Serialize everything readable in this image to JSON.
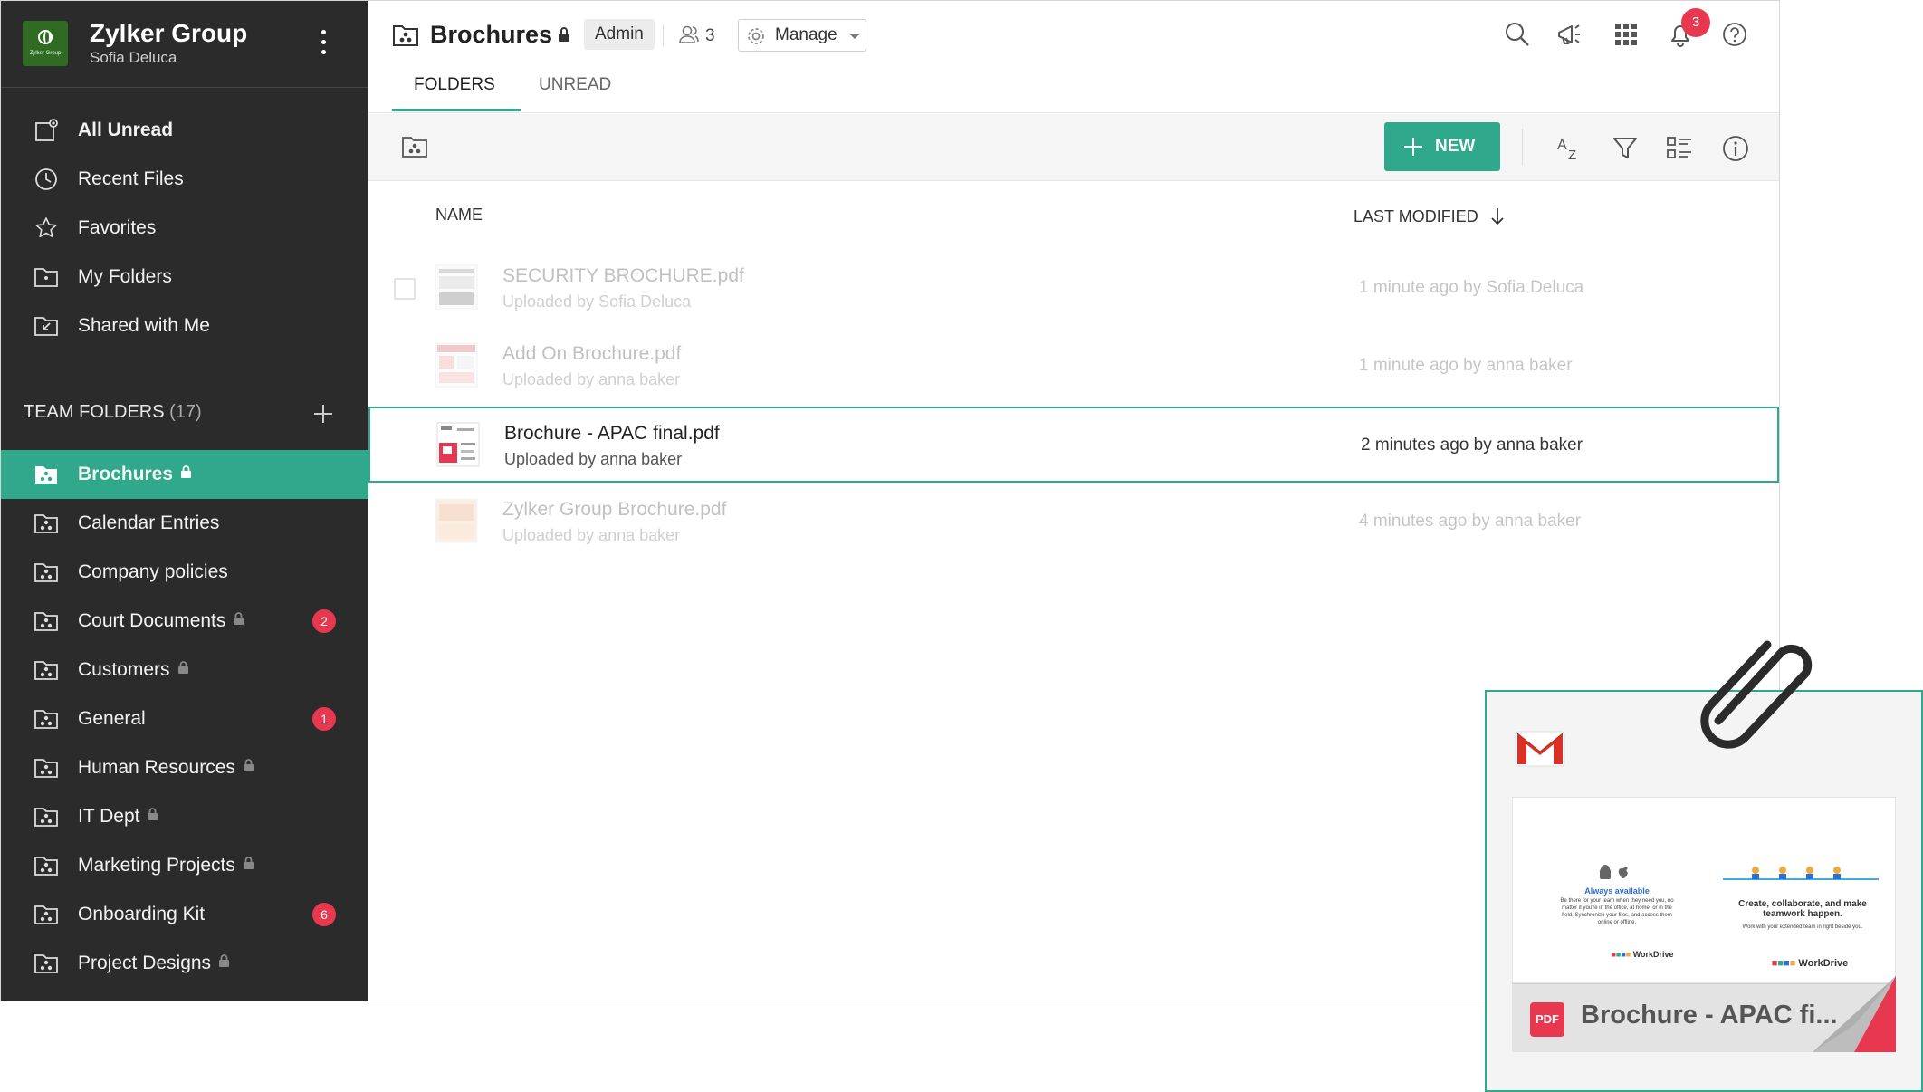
{
  "org": {
    "name": "Zylker Group",
    "user": "Sofia Deluca",
    "logo_text": "Zylker Group"
  },
  "sidebar": {
    "nav": [
      {
        "label": "All Unread",
        "icon": "all-unread-icon"
      },
      {
        "label": "Recent Files",
        "icon": "clock-icon"
      },
      {
        "label": "Favorites",
        "icon": "star-icon"
      },
      {
        "label": "My Folders",
        "icon": "folder-icon"
      },
      {
        "label": "Shared with Me",
        "icon": "shared-folder-icon"
      }
    ],
    "team_header": "TEAM FOLDERS",
    "team_count": "(17)",
    "team_folders": [
      {
        "label": "Brochures",
        "locked": true,
        "badge": ""
      },
      {
        "label": "Calendar Entries",
        "locked": false,
        "badge": ""
      },
      {
        "label": "Company policies",
        "locked": false,
        "badge": ""
      },
      {
        "label": "Court Documents",
        "locked": true,
        "badge": "2"
      },
      {
        "label": "Customers",
        "locked": true,
        "badge": ""
      },
      {
        "label": "General",
        "locked": false,
        "badge": "1"
      },
      {
        "label": "Human Resources",
        "locked": true,
        "badge": ""
      },
      {
        "label": "IT Dept",
        "locked": true,
        "badge": ""
      },
      {
        "label": "Marketing Projects",
        "locked": true,
        "badge": ""
      },
      {
        "label": "Onboarding Kit",
        "locked": false,
        "badge": "6"
      },
      {
        "label": "Project Designs",
        "locked": true,
        "badge": ""
      }
    ]
  },
  "header": {
    "title": "Brochures",
    "role": "Admin",
    "member_count": "3",
    "manage_label": "Manage",
    "notification_count": "3"
  },
  "tabs": [
    {
      "label": "FOLDERS"
    },
    {
      "label": "UNREAD"
    }
  ],
  "toolbar": {
    "new_label": "NEW"
  },
  "columns": {
    "name": "NAME",
    "modified": "LAST MODIFIED"
  },
  "files": [
    {
      "name": "SECURITY BROCHURE.pdf",
      "sub": "Uploaded by Sofia Deluca",
      "modified": "1 minute ago by Sofia Deluca"
    },
    {
      "name": "Add On Brochure.pdf",
      "sub": "Uploaded by anna baker",
      "modified": "1 minute ago by anna baker"
    },
    {
      "name": "Brochure - APAC final.pdf",
      "sub": "Uploaded by anna baker",
      "modified": "2 minutes ago by anna baker"
    },
    {
      "name": "Zylker Group Brochure.pdf",
      "sub": "Uploaded by anna baker",
      "modified": "4 minutes ago by anna baker"
    }
  ],
  "attachment": {
    "file_label": "Brochure - APAC fi...",
    "type": "PDF",
    "preview": {
      "heading_left": "Always available",
      "body_left": "Be there for your team when they need you, no matter if you're in the office, at home, or in the field. Synchronize your files, and access them online or offline.",
      "heading_right": "Create, collaborate, and make teamwork happen.",
      "body_right": "Work with your extended team in right beside you.",
      "brand": "WorkDrive"
    }
  },
  "colors": {
    "accent": "#2fa88b",
    "sidebar_bg": "#2b2b2b",
    "badge": "#e8384f"
  }
}
